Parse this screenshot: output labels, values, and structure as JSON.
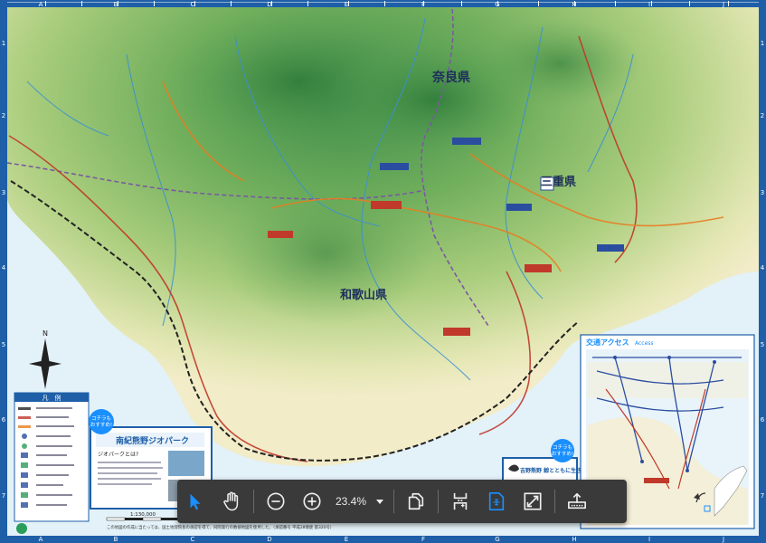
{
  "map": {
    "pref_nara": "奈良県",
    "pref_mie": "三重県",
    "pref_wakayama": "和歌山県",
    "column_labels": [
      "A",
      "B",
      "C",
      "D",
      "E",
      "F",
      "G",
      "H",
      "I",
      "J"
    ],
    "row_labels": [
      "1",
      "2",
      "3",
      "4",
      "5",
      "6",
      "7"
    ],
    "legend_title": "凡　例",
    "scale_text": "1:130,000",
    "footer_note": "この地図の作成に当たっては、国土地理院長の承認を得て、同院発行の数値地図を使用した。（承認番号 平成28情使 第320号）",
    "promo_left_title": "南紀熊野ジオパーク",
    "promo_left_sub": "ジオパークとは?",
    "badge_text_1": "コチラも",
    "badge_text_2": "おすすめ!",
    "promo_right_title": "吉野熊野 鯨とともに生きる",
    "access_title": "交通アクセス",
    "access_sub": "Access"
  },
  "toolbar": {
    "zoom_value": "23.4%",
    "icons": [
      "cursor-icon",
      "hand-icon",
      "zoom-out-icon",
      "zoom-in-icon",
      "pages-icon",
      "fit-page-icon",
      "fit-selection-icon",
      "fullscreen-icon",
      "export-icon"
    ]
  },
  "colors": {
    "frame": "#1e5fa8",
    "toolbar": "#3a3a3a",
    "accent": "#1a8fff",
    "sea": "#e3f1f8"
  }
}
